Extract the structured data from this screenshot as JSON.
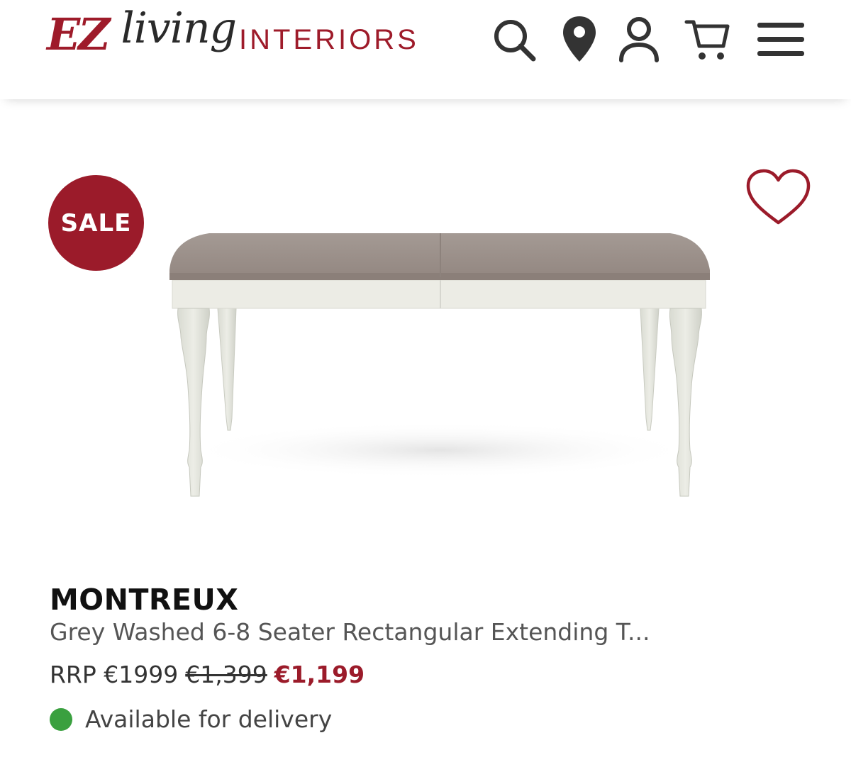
{
  "header": {
    "logo": {
      "ez": "EZ",
      "living": "living",
      "interiors": "INTERIORS"
    },
    "icons": [
      {
        "name": "search-icon"
      },
      {
        "name": "location-pin-icon"
      },
      {
        "name": "account-icon"
      },
      {
        "name": "cart-icon"
      },
      {
        "name": "menu-icon"
      }
    ]
  },
  "product": {
    "badge": "SALE",
    "wishlist_icon": "heart-icon",
    "brand": "MONTREUX",
    "title": "Grey Washed 6-8 Seater Rectangular Extending T...",
    "price": {
      "rrp": "RRP €1999",
      "was": "€1,399",
      "now": "€1,199"
    },
    "availability": "Available for delivery"
  },
  "colors": {
    "brand_red": "#9b1b2a",
    "available_green": "#3aa03f"
  }
}
